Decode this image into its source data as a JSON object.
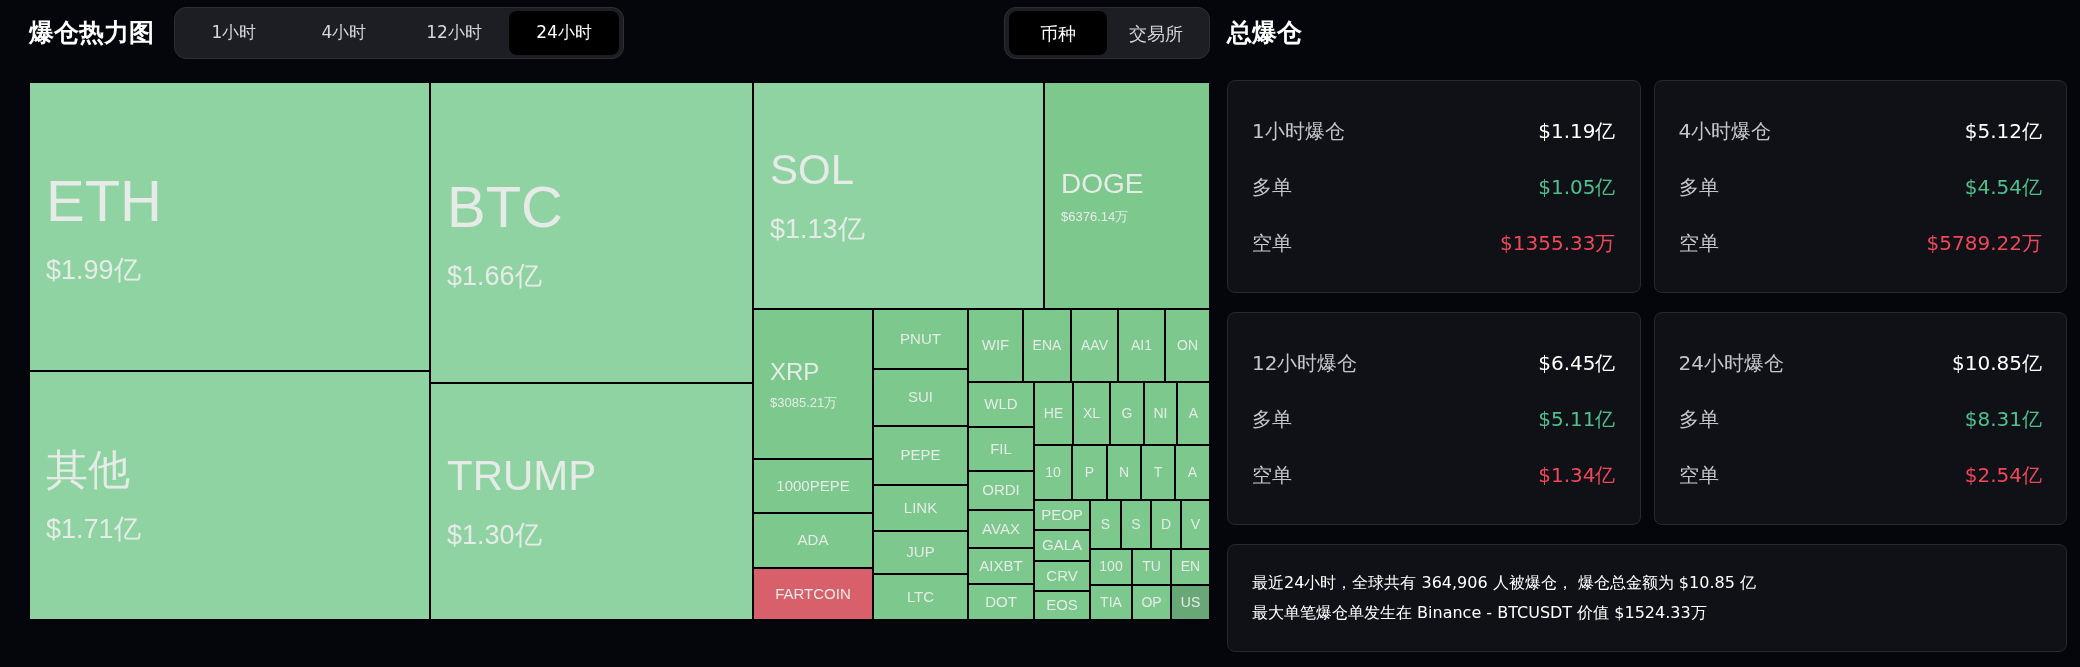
{
  "header": {
    "title": "爆仓热力图",
    "time_tabs": [
      {
        "label": "1小时",
        "selected": false
      },
      {
        "label": "4小时",
        "selected": false
      },
      {
        "label": "12小时",
        "selected": false
      },
      {
        "label": "24小时",
        "selected": true
      }
    ],
    "group_tabs": [
      {
        "label": "币种",
        "selected": true
      },
      {
        "label": "交易所",
        "selected": false
      }
    ]
  },
  "treemap": [
    {
      "symbol": "ETH",
      "value": "$1.99亿",
      "color": "#90d3a3"
    },
    {
      "symbol": "其他",
      "value": "$1.71亿",
      "color": "#90d3a3"
    },
    {
      "symbol": "BTC",
      "value": "$1.66亿",
      "color": "#90d3a3"
    },
    {
      "symbol": "TRUMP",
      "value": "$1.30亿",
      "color": "#90d3a3"
    },
    {
      "symbol": "SOL",
      "value": "$1.13亿",
      "color": "#90d3a3"
    },
    {
      "symbol": "DOGE",
      "value": "$6376.14万",
      "color": "#7cc88d"
    },
    {
      "symbol": "XRP",
      "value": "$3085.21万",
      "color": "#7cc88d"
    },
    {
      "symbol": "1000PEPE",
      "color": "#7cc88d"
    },
    {
      "symbol": "ADA",
      "color": "#7cc88d"
    },
    {
      "symbol": "FARTCOIN",
      "color": "#d8606a"
    },
    {
      "symbol": "PNUT",
      "color": "#7cc88d"
    },
    {
      "symbol": "SUI",
      "color": "#7cc88d"
    },
    {
      "symbol": "PEPE",
      "color": "#7cc88d"
    },
    {
      "symbol": "LINK",
      "color": "#7cc88d"
    },
    {
      "symbol": "JUP",
      "color": "#7cc88d"
    },
    {
      "symbol": "LTC",
      "color": "#7cc88d"
    },
    {
      "symbol": "WIF",
      "color": "#7cc88d"
    },
    {
      "symbol": "ENA",
      "color": "#7cc88d"
    },
    {
      "symbol": "AAV",
      "color": "#7cc88d"
    },
    {
      "symbol": "AI1",
      "color": "#7cc88d"
    },
    {
      "symbol": "ON",
      "color": "#7cc88d"
    },
    {
      "symbol": "WLD",
      "color": "#7cc88d"
    },
    {
      "symbol": "FIL",
      "color": "#7cc88d"
    },
    {
      "symbol": "ORDI",
      "color": "#7cc88d"
    },
    {
      "symbol": "AVAX",
      "color": "#7cc88d"
    },
    {
      "symbol": "AIXBT",
      "color": "#7cc88d"
    },
    {
      "symbol": "DOT",
      "color": "#7cc88d"
    },
    {
      "symbol": "HE",
      "color": "#7cc88d"
    },
    {
      "symbol": "XL",
      "color": "#7cc88d"
    },
    {
      "symbol": "G",
      "color": "#7cc88d"
    },
    {
      "symbol": "NI",
      "color": "#7cc88d"
    },
    {
      "symbol": "A",
      "color": "#7cc88d"
    },
    {
      "symbol": "10",
      "color": "#7cc88d"
    },
    {
      "symbol": "P",
      "color": "#7cc88d"
    },
    {
      "symbol": "N",
      "color": "#7cc88d"
    },
    {
      "symbol": "T",
      "color": "#7cc88d"
    },
    {
      "symbol": "A",
      "color": "#7cc88d"
    },
    {
      "symbol": "PEOP",
      "color": "#7cc88d"
    },
    {
      "symbol": "GALA",
      "color": "#7cc88d"
    },
    {
      "symbol": "CRV",
      "color": "#7cc88d"
    },
    {
      "symbol": "EOS",
      "color": "#7cc88d"
    },
    {
      "symbol": "S",
      "color": "#7cc88d"
    },
    {
      "symbol": "S",
      "color": "#7cc88d"
    },
    {
      "symbol": "D",
      "color": "#7cc88d"
    },
    {
      "symbol": "V",
      "color": "#7cc88d"
    },
    {
      "symbol": "100",
      "color": "#7cc88d"
    },
    {
      "symbol": "TIA",
      "color": "#7cc88d"
    },
    {
      "symbol": "TU",
      "color": "#7cc88d"
    },
    {
      "symbol": "OP",
      "color": "#7cc88d"
    },
    {
      "symbol": "EN",
      "color": "#7cc88d"
    },
    {
      "symbol": "US",
      "color": "#68a877"
    }
  ],
  "summary": {
    "title": "总爆仓",
    "cards": [
      {
        "title": "1小时爆仓",
        "total": "$1.19亿",
        "long_label": "多单",
        "long": "$1.05亿",
        "short_label": "空单",
        "short": "$1355.33万"
      },
      {
        "title": "4小时爆仓",
        "total": "$5.12亿",
        "long_label": "多单",
        "long": "$4.54亿",
        "short_label": "空单",
        "short": "$5789.22万"
      },
      {
        "title": "12小时爆仓",
        "total": "$6.45亿",
        "long_label": "多单",
        "long": "$5.11亿",
        "short_label": "空单",
        "short": "$1.34亿"
      },
      {
        "title": "24小时爆仓",
        "total": "$10.85亿",
        "long_label": "多单",
        "long": "$8.31亿",
        "short_label": "空单",
        "short": "$2.54亿"
      }
    ],
    "notes": [
      "最近24小时，全球共有 364,906 人被爆仓， 爆仓总金额为 $10.85 亿",
      "最大单笔爆仓单发生在 Binance - BTCUSDT 价值 $1524.33万"
    ]
  }
}
